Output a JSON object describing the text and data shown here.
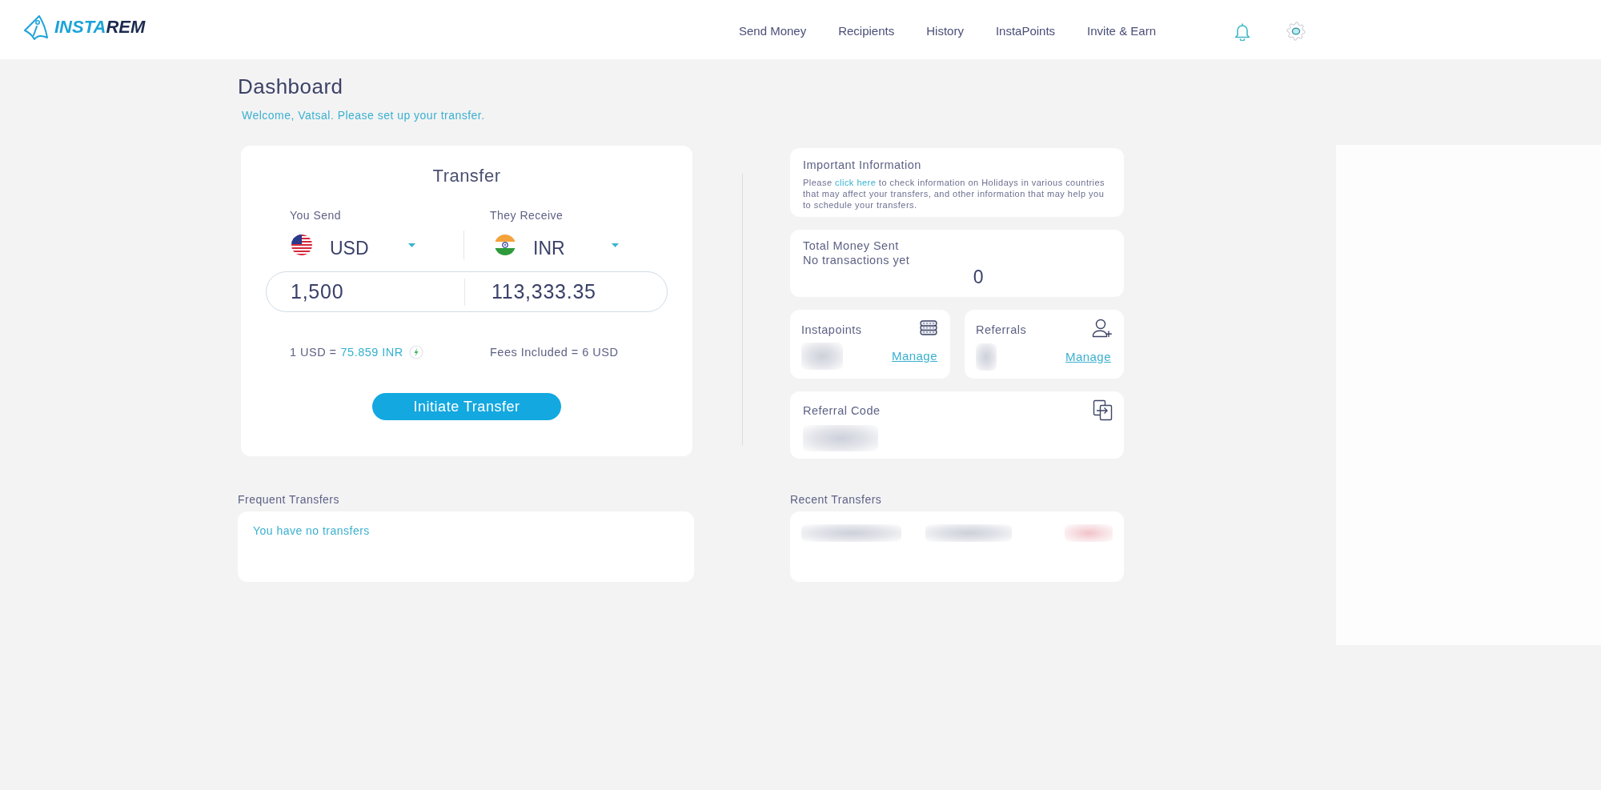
{
  "header": {
    "logo": {
      "parts": [
        {
          "text": "INSTA",
          "color": "#1ca3d9"
        },
        {
          "text": "REM",
          "color": "#1c2b4f"
        }
      ]
    },
    "nav": [
      {
        "label": "Send Money",
        "selected": false
      },
      {
        "label": "Recipients",
        "selected": false
      },
      {
        "label": "History",
        "selected": false
      },
      {
        "label": "InstaPoints",
        "selected": false
      },
      {
        "label": "Invite & Earn",
        "selected": false
      }
    ]
  },
  "page": {
    "title": "Dashboard",
    "welcome": "Welcome, Vatsal. Please set up your transfer."
  },
  "transfer": {
    "title": "Transfer",
    "sides": [
      {
        "label": "You Send",
        "kind": "us",
        "currency": "USD",
        "amount": "1,500"
      },
      {
        "label": "They Receive",
        "kind": "in",
        "currency": "INR",
        "amount": "113,333.35"
      }
    ],
    "rate": {
      "prefix": "1 USD =",
      "value": "75.859 INR"
    },
    "fees": "Fees Included = 6 USD",
    "button": "Initiate Transfer"
  },
  "important_information": {
    "title": "Important Information",
    "text_before": "Please",
    "link": "click here",
    "text_after": "to check information on Holidays in various countries that may affect your transfers, and other information that may help you to schedule your transfers."
  },
  "total_money_sent": {
    "title": "Total Money Sent",
    "subtitle": "No transactions yet",
    "amount": "0"
  },
  "stats": [
    {
      "kind": "points",
      "title": "Instapoints",
      "redacted": true,
      "link": "Manage"
    },
    {
      "kind": "referrals",
      "title": "Referrals",
      "redacted": true,
      "link": "Manage"
    }
  ],
  "referral_code": {
    "title": "Referral Code",
    "redacted": true
  },
  "frequent_transfers": {
    "title": "Frequent Transfers",
    "empty_text": "You have no transfers"
  },
  "recent_transfers": {
    "title": "Recent Transfers",
    "redacted": true
  }
}
